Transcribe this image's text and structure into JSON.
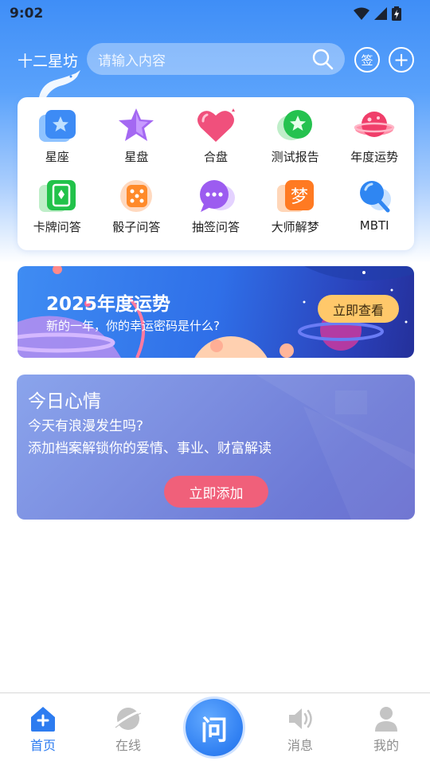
{
  "status_bar": {
    "time": "9:02"
  },
  "header": {
    "app_title": "十二星坊",
    "search_placeholder": "请输入内容",
    "sign_label": "签",
    "add_label": "+"
  },
  "grid": {
    "items": [
      {
        "label": "星座",
        "icon": "star-badge-icon"
      },
      {
        "label": "星盘",
        "icon": "purple-star-icon"
      },
      {
        "label": "合盘",
        "icon": "heart-icon"
      },
      {
        "label": "测试报告",
        "icon": "green-star-icon"
      },
      {
        "label": "年度运势",
        "icon": "planet-icon"
      },
      {
        "label": "卡牌问答",
        "icon": "card-icon"
      },
      {
        "label": "骰子问答",
        "icon": "dice-icon"
      },
      {
        "label": "抽签问答",
        "icon": "chat-bubble-icon"
      },
      {
        "label": "大师解梦",
        "icon": "dream-icon"
      },
      {
        "label": "MBTI",
        "icon": "magnifier-icon"
      }
    ]
  },
  "banner": {
    "title": "2025年度运势",
    "subtitle": "新的一年，你的幸运密码是什么?",
    "button": "立即查看"
  },
  "mood": {
    "title": "今日心情",
    "line1": "今天有浪漫发生吗?",
    "line2": "添加档案解锁你的爱情、事业、财富解读",
    "button": "立即添加"
  },
  "bottom_nav": {
    "home": "首页",
    "online": "在线",
    "ask": "问",
    "messages": "消息",
    "mine": "我的"
  },
  "colors": {
    "accent": "#2d7cf0",
    "banner_button": "#ffc86a",
    "mood_button": "#f0607a"
  }
}
